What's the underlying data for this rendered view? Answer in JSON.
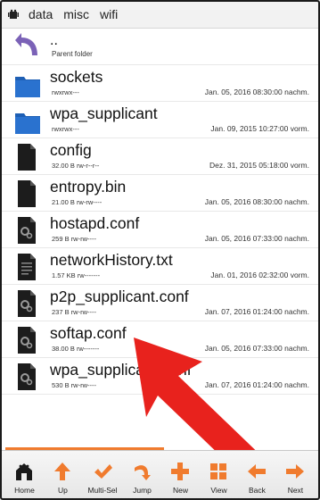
{
  "breadcrumb": {
    "root_icon": "android-home-icon",
    "items": [
      "data",
      "misc",
      "wifi"
    ]
  },
  "files": [
    {
      "name": "..",
      "meta": "Parent folder",
      "date": "",
      "icon": "up-arrow-icon",
      "kind": "parent"
    },
    {
      "name": "sockets",
      "meta": "rwxrwx---",
      "date": "Jan. 05, 2016 08:30:00 nachm.",
      "icon": "folder-icon",
      "kind": "folder"
    },
    {
      "name": "wpa_supplicant",
      "meta": "rwxrwx---",
      "date": "Jan. 09, 2015 10:27:00 vorm.",
      "icon": "folder-icon",
      "kind": "folder"
    },
    {
      "name": "config",
      "meta": "32.00 B rw-r--r--",
      "date": "Dez. 31, 2015 05:18:00 vorm.",
      "icon": "file-icon",
      "kind": "file"
    },
    {
      "name": "entropy.bin",
      "meta": "21.00 B rw-rw----",
      "date": "Jan. 05, 2016 08:30:00 nachm.",
      "icon": "file-icon",
      "kind": "file"
    },
    {
      "name": "hostapd.conf",
      "meta": "259 B rw-rw----",
      "date": "Jan. 05, 2016 07:33:00 nachm.",
      "icon": "gear-file-icon",
      "kind": "conf"
    },
    {
      "name": "networkHistory.txt",
      "meta": "1.57 KB rw-------",
      "date": "Jan. 01, 2016 02:32:00 vorm.",
      "icon": "text-file-icon",
      "kind": "txt"
    },
    {
      "name": "p2p_supplicant.conf",
      "meta": "237 B rw-rw----",
      "date": "Jan. 07, 2016 01:24:00 nachm.",
      "icon": "gear-file-icon",
      "kind": "conf"
    },
    {
      "name": "softap.conf",
      "meta": "38.00 B rw-------",
      "date": "Jan. 05, 2016 07:33:00 nachm.",
      "icon": "gear-file-icon",
      "kind": "conf"
    },
    {
      "name": "wpa_supplicant.conf",
      "meta": "530 B rw-rw----",
      "date": "Jan. 07, 2016 01:24:00 nachm.",
      "icon": "gear-file-icon",
      "kind": "conf"
    }
  ],
  "toolbar": [
    {
      "label": "Home",
      "icon": "home-icon"
    },
    {
      "label": "Up",
      "icon": "up-arrow-icon"
    },
    {
      "label": "Multi-Sel",
      "icon": "checkmark-icon"
    },
    {
      "label": "Jump",
      "icon": "jump-arrow-icon"
    },
    {
      "label": "New",
      "icon": "plus-icon"
    },
    {
      "label": "View",
      "icon": "grid-view-icon"
    },
    {
      "label": "Back",
      "icon": "left-arrow-icon"
    },
    {
      "label": "Next",
      "icon": "right-arrow-icon"
    }
  ],
  "colors": {
    "accent_orange": "#f07b2e",
    "folder_blue": "#1e5fb4",
    "file_black": "#1c1c1c",
    "annotation_red": "#e8221d",
    "back_purple": "#7b62b7"
  }
}
